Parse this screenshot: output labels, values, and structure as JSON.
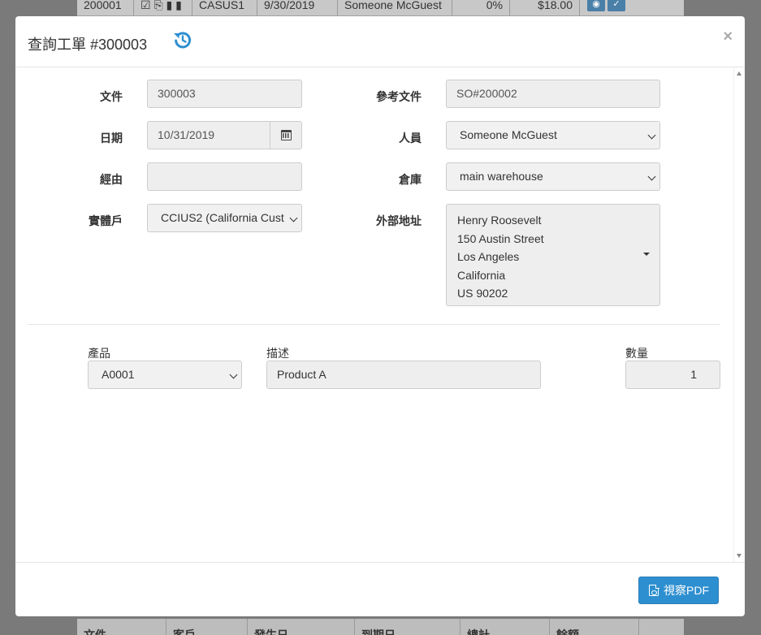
{
  "background": {
    "top_row": [
      "200001",
      "CASUS1",
      "9/30/2019",
      "Someone McGuest",
      "0%",
      "$18.00"
    ],
    "bottom_headers": [
      "文件",
      "客戶",
      "發生日",
      "到期日",
      "總計",
      "餘額"
    ]
  },
  "modal": {
    "title": "查詢工單 #300003",
    "close": "×"
  },
  "form": {
    "doc_label": "文件",
    "doc_value": "300003",
    "ref_label": "參考文件",
    "ref_value": "SO#200002",
    "date_label": "日期",
    "date_value": "10/31/2019",
    "person_label": "人員",
    "person_value": "Someone McGuest",
    "via_label": "經由",
    "via_value": "",
    "warehouse_label": "倉庫",
    "warehouse_value": "main warehouse",
    "entity_label": "實體戶",
    "entity_value": "CCIUS2 (California Cust",
    "address_label": "外部地址",
    "address_lines": [
      "Henry Roosevelt",
      "150 Austin Street",
      "Los Angeles",
      "California",
      "US 90202"
    ]
  },
  "lines": {
    "product_header": "產品",
    "description_header": "描述",
    "quantity_header": "數量",
    "items": [
      {
        "product": "A0001",
        "description": "Product A",
        "quantity": "1"
      }
    ]
  },
  "footer": {
    "pdf_button": "視察PDF"
  },
  "colors": {
    "primary": "#2e8fd0",
    "history_icon": "#2e8fd0",
    "overlay": "#7a7a7a"
  }
}
